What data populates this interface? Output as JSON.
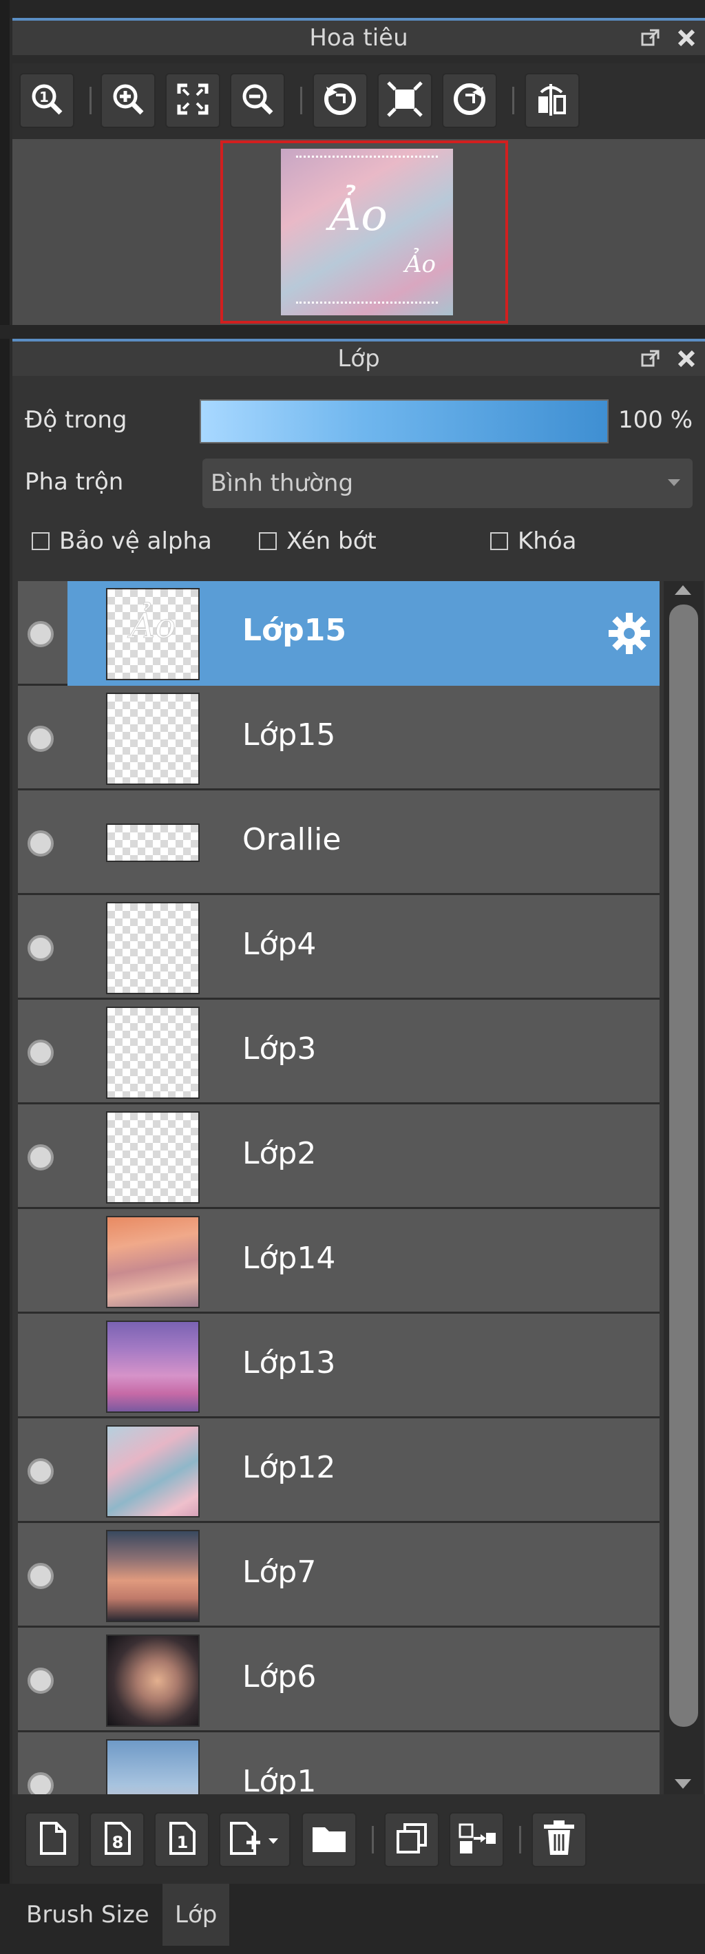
{
  "navigator": {
    "title": "Hoa tiêu",
    "preview_text_main": "Ảo",
    "preview_text_small": "Ảo"
  },
  "toolbar_icons": [
    "zoom-actual-icon",
    "zoom-in-icon",
    "fit-screen-icon",
    "zoom-out-icon",
    "rotate-left-icon",
    "fit-frame-icon",
    "rotate-right-icon",
    "flip-icon"
  ],
  "layers_panel": {
    "title": "Lớp",
    "opacity_label": "Độ trong",
    "opacity_value": "100 %",
    "opacity_percent": 100,
    "blend_label": "Pha trộn",
    "blend_value": "Bình thường",
    "protect_alpha_label": "Bảo vệ alpha",
    "clipping_label": "Xén bớt",
    "lock_label": "Khóa"
  },
  "layers": [
    {
      "name": "Lớp15",
      "visible": true,
      "selected": true,
      "thumb": "transparent-text"
    },
    {
      "name": "Lớp15",
      "visible": true,
      "selected": false,
      "thumb": "transparent"
    },
    {
      "name": "Orallie",
      "visible": true,
      "selected": false,
      "thumb": "transparent-short"
    },
    {
      "name": "Lớp4",
      "visible": true,
      "selected": false,
      "thumb": "transparent"
    },
    {
      "name": "Lớp3",
      "visible": true,
      "selected": false,
      "thumb": "transparent"
    },
    {
      "name": "Lớp2",
      "visible": true,
      "selected": false,
      "thumb": "transparent"
    },
    {
      "name": "Lớp14",
      "visible": false,
      "selected": false,
      "thumb": "sunset-clouds"
    },
    {
      "name": "Lớp13",
      "visible": false,
      "selected": false,
      "thumb": "purple-sky"
    },
    {
      "name": "Lớp12",
      "visible": true,
      "selected": false,
      "thumb": "pastel-sky"
    },
    {
      "name": "Lớp7",
      "visible": true,
      "selected": false,
      "thumb": "house-clouds"
    },
    {
      "name": "Lớp6",
      "visible": true,
      "selected": false,
      "thumb": "dark-clouds"
    },
    {
      "name": "Lớp1",
      "visible": true,
      "selected": false,
      "thumb": "blue-sky"
    }
  ],
  "bottom_toolbar_icons": [
    "new-layer-icon",
    "new-8bit-layer-icon",
    "new-1bit-layer-icon",
    "add-layer-menu-icon",
    "folder-icon",
    "duplicate-icon",
    "merge-down-icon",
    "delete-icon"
  ],
  "tabs": [
    {
      "label": "Brush Size",
      "active": false
    },
    {
      "label": "Lớp",
      "active": true
    }
  ],
  "colors": {
    "accent": "#5a9dd6",
    "header_border": "#5b8ec4",
    "nav_frame": "#d21f1f",
    "row_bg": "#585858"
  }
}
